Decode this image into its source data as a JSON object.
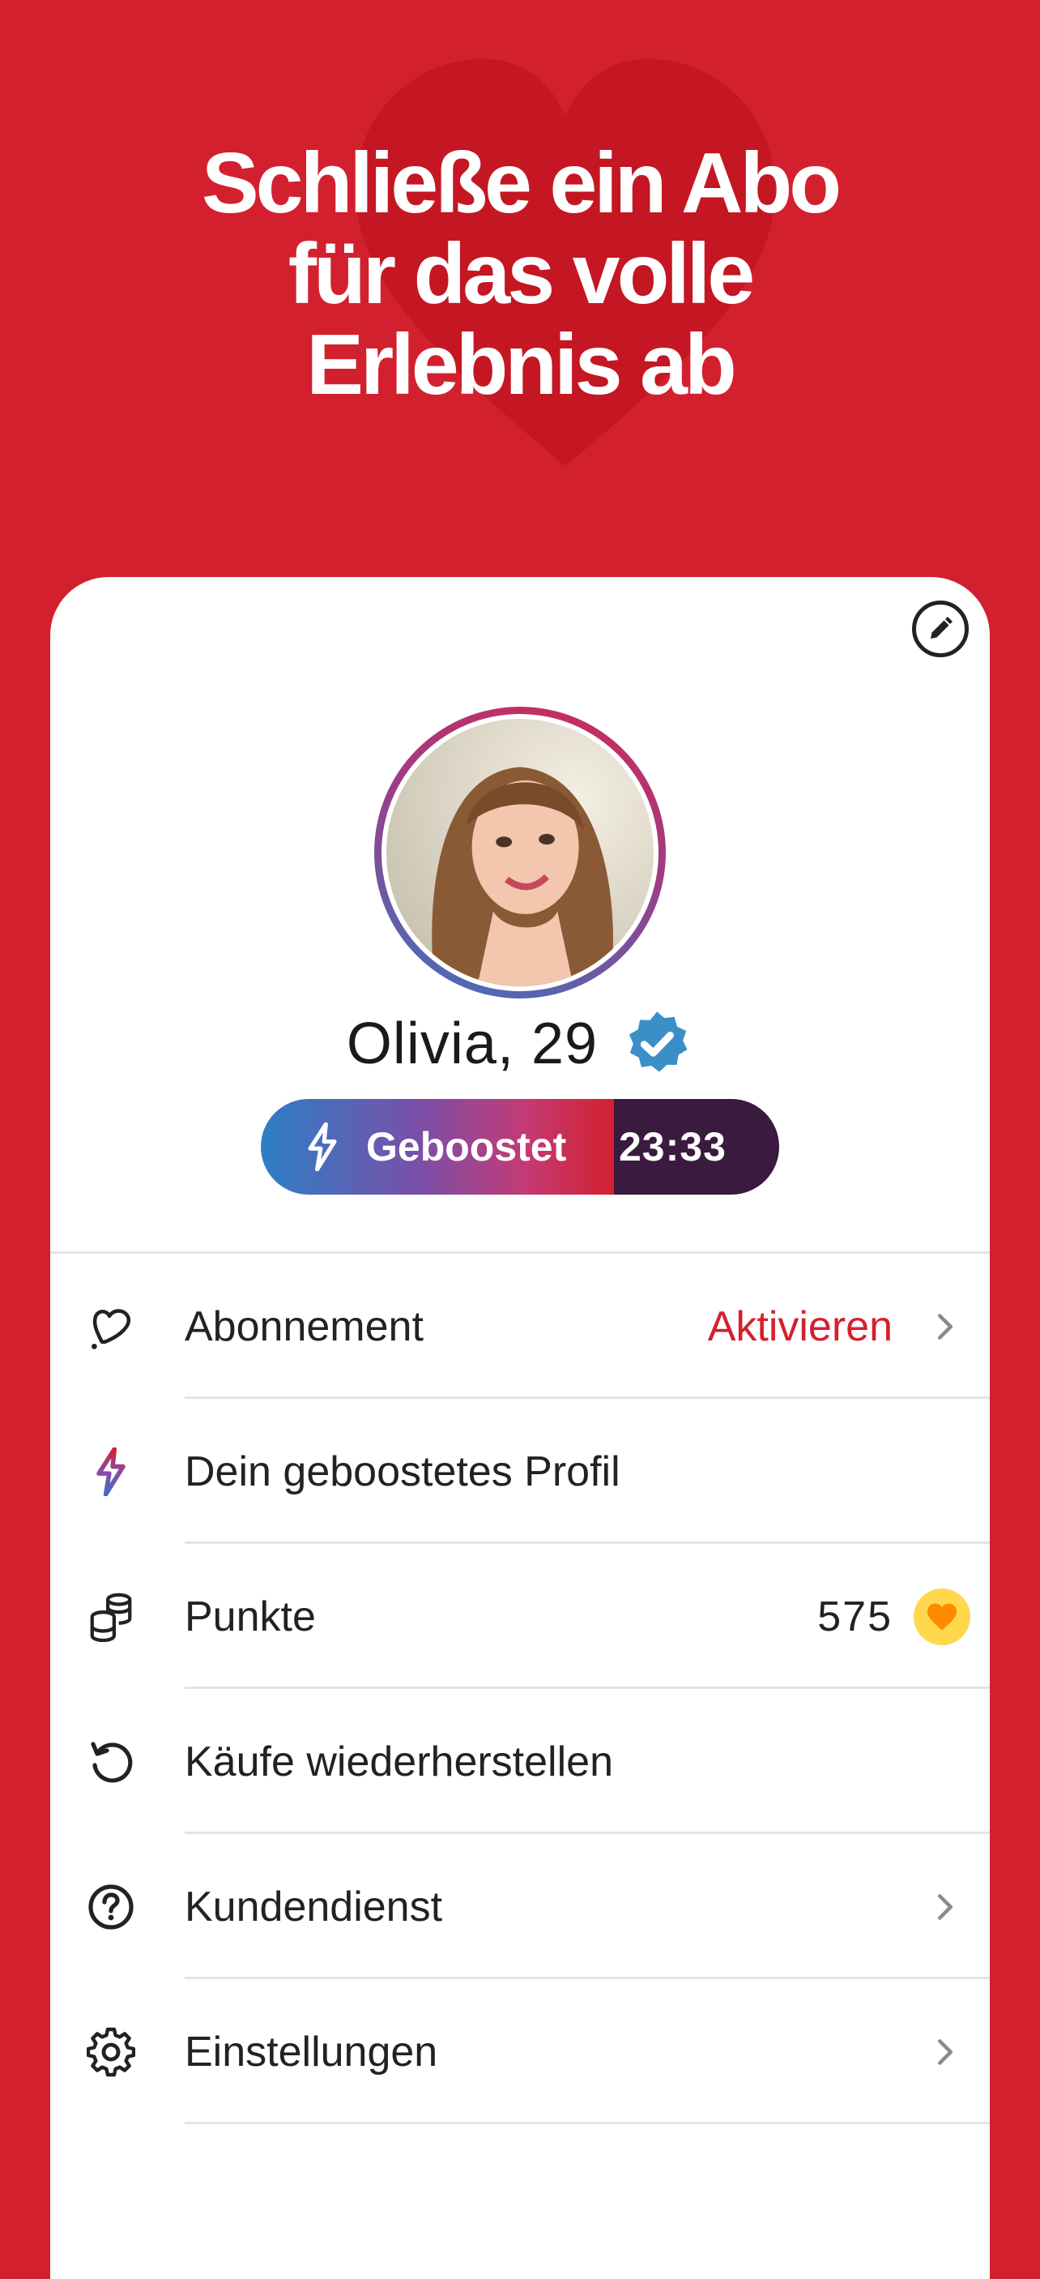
{
  "header": {
    "headline_lines": [
      "Schließe ein Abo",
      "für das volle",
      "Erlebnis ab"
    ]
  },
  "profile": {
    "name_age": "Olivia, 29",
    "verified": true,
    "boost_label": "Geboostet",
    "boost_timer": "23:33"
  },
  "menu": {
    "items": [
      {
        "label": "Abonnement",
        "action": "Aktivieren",
        "icon": "heart-outline-icon"
      },
      {
        "label": "Dein geboostetes Profil",
        "icon": "bolt-icon"
      },
      {
        "label": "Punkte",
        "value": "575",
        "icon": "coins-icon"
      },
      {
        "label": "Käufe wiederherstellen",
        "icon": "restore-icon"
      },
      {
        "label": "Kundendienst",
        "icon": "help-icon"
      },
      {
        "label": "Einstellungen",
        "icon": "gear-icon"
      }
    ]
  },
  "colors": {
    "brand_red": "#D3202F",
    "boost_dark": "#3A1A3E",
    "coin_yellow": "#FFD84D",
    "coin_heart": "#FF8A00"
  }
}
